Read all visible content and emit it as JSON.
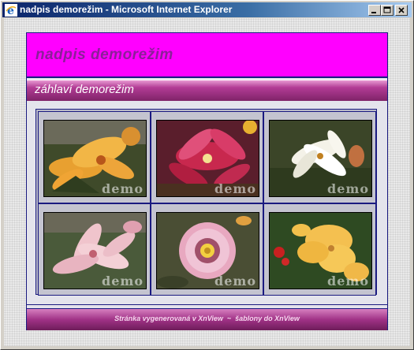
{
  "window": {
    "title": "nadpis demorežim - Microsoft Internet Explorer",
    "icon": "ie-logo-icon",
    "controls": [
      "minimize",
      "maximize",
      "close"
    ]
  },
  "page": {
    "banner_title": "nadpis demorežim",
    "subheader": "záhlaví demorežim",
    "footer": "Stránka vygenerovaná v XnView  ~  šablony do XnView"
  },
  "gallery": {
    "watermark": "demo",
    "items": [
      {
        "name": "orange-lily-thumbnail",
        "flower": "orange lily"
      },
      {
        "name": "red-lily-thumbnail",
        "flower": "red lily"
      },
      {
        "name": "white-lily-thumbnail",
        "flower": "white lily"
      },
      {
        "name": "pink-lily-thumbnail",
        "flower": "pink lily"
      },
      {
        "name": "gazania-thumbnail",
        "flower": "gazania"
      },
      {
        "name": "yellow-daylily-thumbnail",
        "flower": "yellow daylily"
      }
    ]
  },
  "colors": {
    "titlebar": "#0a246a",
    "banner": "#ff00ff",
    "banner_text": "#8b1f99",
    "subheader": "#b23c95",
    "border": "#1a1a80"
  }
}
